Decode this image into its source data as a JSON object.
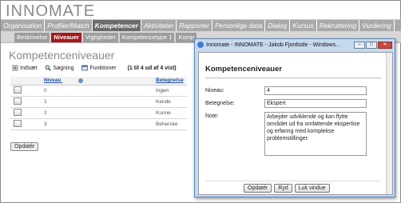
{
  "app": {
    "logo": "INNOMATE"
  },
  "nav": {
    "items": [
      {
        "label": "Organisation"
      },
      {
        "label": "Profiler/Match"
      },
      {
        "label": "Kompetencer"
      },
      {
        "label": "Aktiviteter"
      },
      {
        "label": "Rapporter"
      },
      {
        "label": "Personlige data"
      },
      {
        "label": "Dialog"
      },
      {
        "label": "Kursus"
      },
      {
        "label": "Rekruttering"
      },
      {
        "label": "Vurdering"
      }
    ],
    "active_index": 2
  },
  "subnav": {
    "items": [
      {
        "label": "Beskrivelse"
      },
      {
        "label": "Niveauer"
      },
      {
        "label": "Vigtigheder"
      },
      {
        "label": "Kompetencetype 1"
      },
      {
        "label": "Komp"
      }
    ],
    "active_index": 1
  },
  "page": {
    "title": "Kompetenceniveauer"
  },
  "toolbar": {
    "insert_label": "Indsæt",
    "search_label": "Søgning",
    "functions_label": "Funktioner",
    "pager_text": "(1 til 4 ud af 4 vist)"
  },
  "table": {
    "columns": [
      "Niveau",
      "Betegnelse"
    ],
    "rows": [
      {
        "niveau": "0",
        "betegnelse": "Ingen"
      },
      {
        "niveau": "1",
        "betegnelse": "Kende"
      },
      {
        "niveau": "2",
        "betegnelse": "Kunne"
      },
      {
        "niveau": "3",
        "betegnelse": "Beherske"
      }
    ]
  },
  "update_button": "Opdatér",
  "popup": {
    "window_title": "Innomate - INNOMATE - Jakob Fjordside - Windows...",
    "heading": "Kompetenceniveauer",
    "niveau_label": "Niveau:",
    "niveau_value": "4",
    "betegnelse_label": "Betegnelse:",
    "betegnelse_value": "Ekspert",
    "note_label": "Note:",
    "note_value": "Arbejder udviklende og kan flytte området ud fra omfattende ekspertise og erfaring med komplekse problemstillinger.",
    "update_label": "Opdatér",
    "clear_label": "Ryd",
    "close_label": "Luk vindue"
  }
}
